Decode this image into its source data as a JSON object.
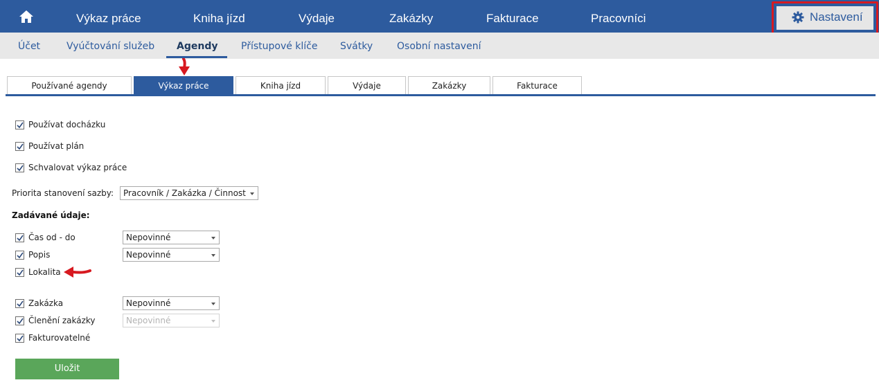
{
  "top_nav": {
    "items": [
      "Výkaz práce",
      "Kniha jízd",
      "Výdaje",
      "Zakázky",
      "Fakturace",
      "Pracovníci"
    ],
    "settings_label": "Nastavení"
  },
  "sub_nav": {
    "items": [
      "Účet",
      "Vyúčtování služeb",
      "Agendy",
      "Přístupové klíče",
      "Svátky",
      "Osobní nastavení"
    ],
    "active": "Agendy"
  },
  "tabs": {
    "items": [
      "Používané agendy",
      "Výkaz práce",
      "Kniha jízd",
      "Výdaje",
      "Zakázky",
      "Fakturace"
    ],
    "active": "Výkaz práce"
  },
  "form": {
    "options": [
      {
        "label": "Používat docházku",
        "checked": true
      },
      {
        "label": "Používat plán",
        "checked": true
      },
      {
        "label": "Schvalovat výkaz práce",
        "checked": true
      }
    ],
    "rate_priority": {
      "label": "Priorita stanovení sazby:",
      "value": "Pracovník / Zakázka / Činnost"
    },
    "fields_title": "Zadávané údaje:",
    "fields": [
      {
        "label": "Čas od - do",
        "checked": true,
        "requirement": "Nepovinné",
        "enabled": true
      },
      {
        "label": "Popis",
        "checked": true,
        "requirement": "Nepovinné",
        "enabled": true
      },
      {
        "label": "Lokalita",
        "checked": true
      },
      {
        "label": "Zakázka",
        "checked": true,
        "requirement": "Nepovinné",
        "enabled": true
      },
      {
        "label": "Členění zakázky",
        "checked": true,
        "requirement": "Nepovinné",
        "enabled": false
      },
      {
        "label": "Fakturovatelné",
        "checked": true
      }
    ],
    "save_label": "Uložit"
  },
  "colors": {
    "brand_blue": "#2d5b9e",
    "save_green": "#5aa65a",
    "highlight_red": "#d71920"
  }
}
